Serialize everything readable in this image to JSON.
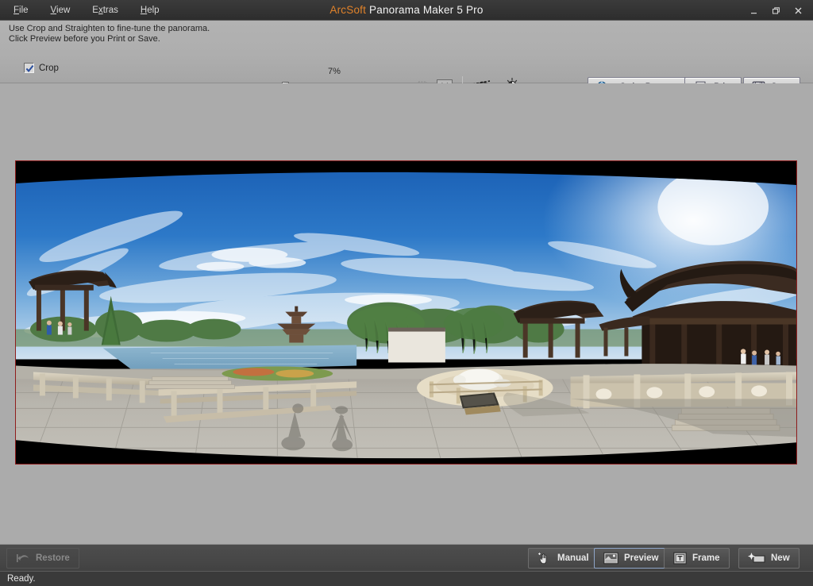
{
  "window": {
    "title_brand": "ArcSoft",
    "title_rest": " Panorama Maker 5 Pro",
    "controls": {
      "minimize": "minimize-icon",
      "restore": "restore-window-icon",
      "close": "close-icon"
    }
  },
  "menubar": {
    "items": [
      {
        "label": "File",
        "accel_index": 0
      },
      {
        "label": "View",
        "accel_index": 0
      },
      {
        "label": "Extras",
        "accel_index": 1
      },
      {
        "label": "Help",
        "accel_index": 0
      }
    ]
  },
  "toolbar": {
    "hint_line1": "Use Crop and Straighten to fine-tune the panorama.",
    "hint_line2": "Click Preview before you Print or Save.",
    "crop_checkbox": {
      "label": "Crop",
      "checked": true
    },
    "zoom": {
      "percent_label": "7%",
      "value": 7,
      "min": 1,
      "max": 100,
      "zoom_out_icon": "zoom-out-icon",
      "zoom_in_icon": "zoom-in-icon",
      "fit_to_window_icon": "fit-to-window-icon",
      "actual_size_label": "1:1"
    },
    "tools": [
      {
        "name": "straighten-tool",
        "icon": "straighten-icon",
        "has_dropdown": true
      },
      {
        "name": "brightness-tool",
        "icon": "brightness-contrast-icon",
        "has_dropdown": true
      }
    ],
    "actions": [
      {
        "label": "Order Panorama",
        "icon": "order-panorama-icon",
        "enabled": true
      },
      {
        "label": "Print",
        "icon": "printer-icon",
        "enabled": true
      },
      {
        "label": "Save",
        "icon": "floppy-disk-icon",
        "enabled": true
      }
    ]
  },
  "canvas": {
    "background_color": "#ababab",
    "crop_border_color": "#8f1d1d",
    "matte_color": "#000000",
    "image": {
      "description": "Stitched wide panorama of a Chinese classical garden: stone-paved plaza, carved balustrades, lake with willows, traditional timber pavilions with upturned eaves, a white stone turtle sculpture, tripod and photographer shadows on the pavement, bright blue sky with wispy cirrus clouds and sun flare at upper right.",
      "sky_top_color": "#1f63b4",
      "sky_bottom_color": "#cfe2f2",
      "pavement_color": "#b9b6ae",
      "wood_color": "#4a352a"
    }
  },
  "bottombar": {
    "buttons": [
      {
        "label": "Restore",
        "icon": "undo-arrow-icon",
        "enabled": false,
        "selected": false
      },
      {
        "label": "Manual",
        "icon": "hand-pointer-icon",
        "enabled": true,
        "selected": false
      },
      {
        "label": "Preview",
        "icon": "preview-image-icon",
        "enabled": true,
        "selected": true
      },
      {
        "label": "Frame",
        "icon": "frame-text-icon",
        "enabled": true,
        "selected": false
      },
      {
        "label": "New",
        "icon": "new-project-icon",
        "enabled": true,
        "selected": false
      }
    ]
  },
  "statusbar": {
    "text": "Ready."
  }
}
